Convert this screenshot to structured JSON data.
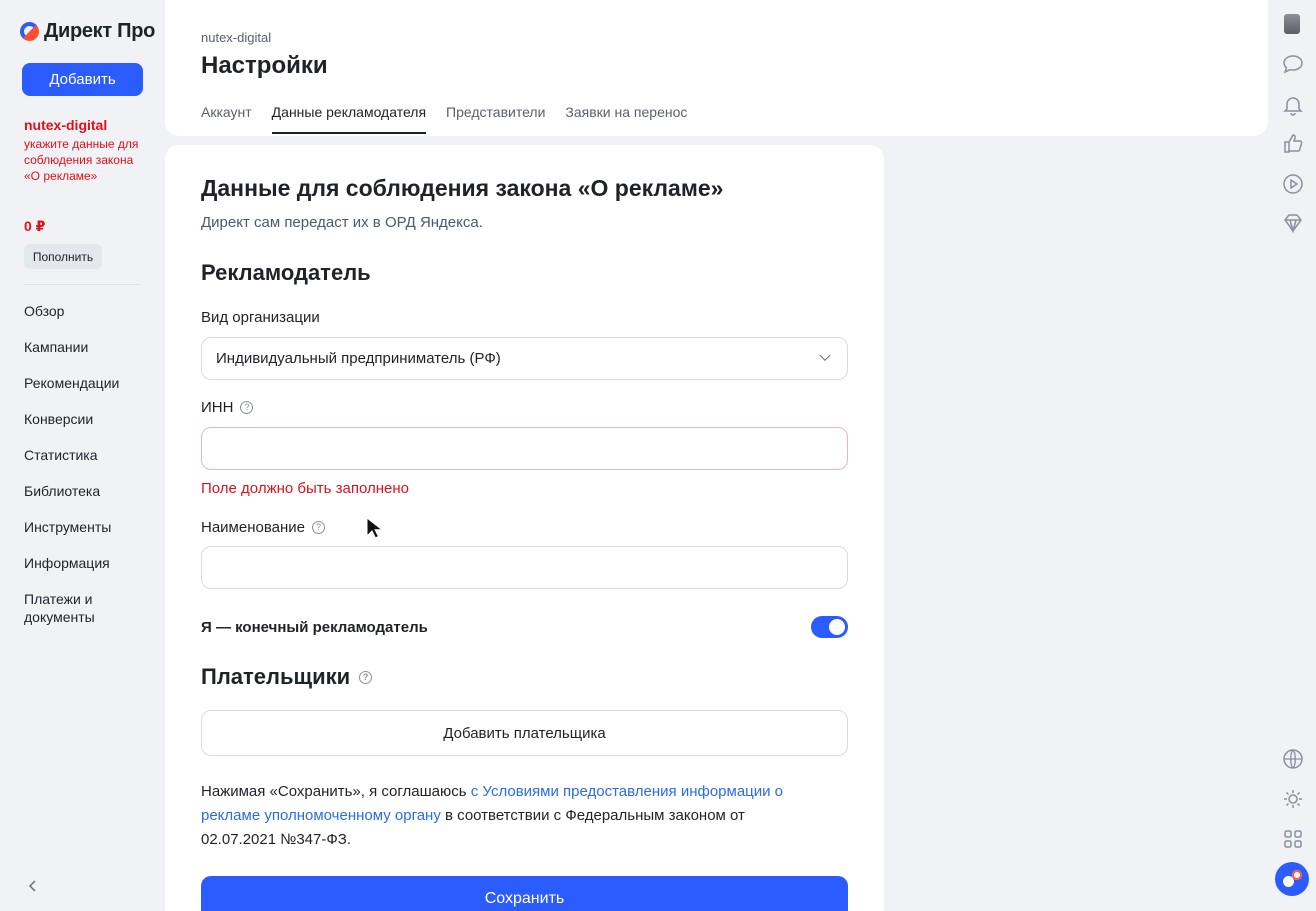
{
  "sidebar": {
    "logo_text": "Директ Про",
    "add_button": "Добавить",
    "account_name": "nutex-digital",
    "account_warning": "укажите данные для соблюдения закона «О рекламе»",
    "balance": "0 ₽",
    "topup_button": "Пополнить",
    "nav": [
      "Обзор",
      "Кампании",
      "Рекомендации",
      "Конверсии",
      "Статистика",
      "Библиотека",
      "Инструменты",
      "Информация",
      "Платежи и документы"
    ],
    "collapse_icon": "chevron-left-icon"
  },
  "header": {
    "breadcrumb": "nutex-digital",
    "title": "Настройки",
    "tabs": [
      {
        "label": "Аккаунт",
        "active": false
      },
      {
        "label": "Данные рекламодателя",
        "active": true
      },
      {
        "label": "Представители",
        "active": false
      },
      {
        "label": "Заявки на перенос",
        "active": false
      }
    ]
  },
  "form": {
    "title": "Данные для соблюдения закона «О рекламе»",
    "subtitle": "Директ сам передаст их в ОРД Яндекса.",
    "advertiser_section": "Рекламодатель",
    "org_type_label": "Вид организации",
    "org_type_value": "Индивидуальный предприниматель (РФ)",
    "inn_label": "ИНН",
    "inn_value": "",
    "inn_error": "Поле должно быть заполнено",
    "name_label": "Наименование",
    "name_value": "",
    "final_advertiser_label": "Я — конечный рекламодатель",
    "final_advertiser_on": true,
    "payers_section": "Плательщики",
    "add_payer_button": "Добавить плательщика",
    "legal_prefix": "Нажимая «Сохранить», я соглашаюсь ",
    "legal_link": "с Условиями предоставления информации о рекламе уполномоченному органу",
    "legal_suffix": " в соответствии с Федеральным законом от 02.07.2021 №347-ФЗ.",
    "save_button": "Сохранить"
  },
  "rail": {
    "icons": [
      "avatar",
      "chat-icon",
      "bell-icon",
      "thumbs-up-icon",
      "play-icon",
      "diamond-icon",
      "globe-icon",
      "theme-icon",
      "apps-grid-icon",
      "brand-icon"
    ]
  },
  "colors": {
    "accent": "#2b5cff",
    "error": "#e0101b",
    "link": "#2a6cf0"
  }
}
